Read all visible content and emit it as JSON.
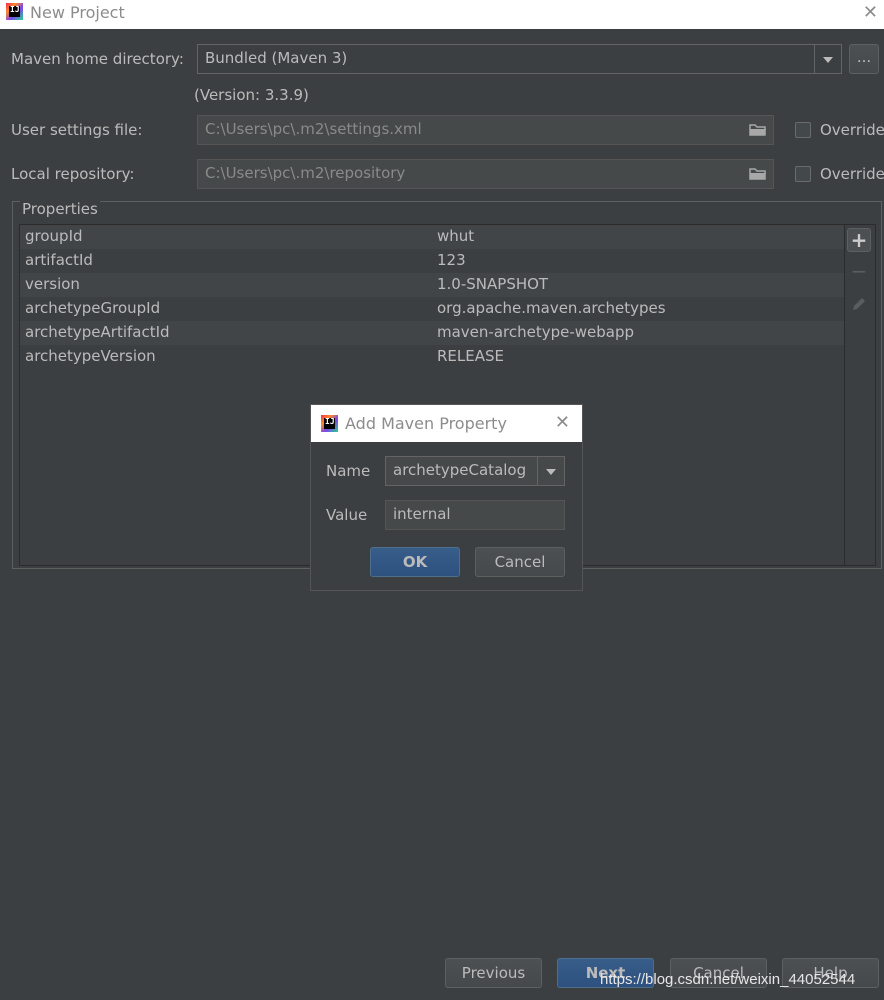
{
  "window": {
    "title": "New Project"
  },
  "maven": {
    "home_label": "Maven home directory:",
    "home_value": "Bundled (Maven 3)",
    "browse_label": "...",
    "version_text": "(Version: 3.3.9)",
    "settings_label": "User settings file:",
    "settings_value": "C:\\Users\\pc\\.m2\\settings.xml",
    "repo_label": "Local repository:",
    "repo_value": "C:\\Users\\pc\\.m2\\repository",
    "override_label": "Override"
  },
  "properties": {
    "legend": "Properties",
    "rows": [
      {
        "key": "groupId",
        "value": "whut"
      },
      {
        "key": "artifactId",
        "value": "123"
      },
      {
        "key": "version",
        "value": "1.0-SNAPSHOT"
      },
      {
        "key": "archetypeGroupId",
        "value": "org.apache.maven.archetypes"
      },
      {
        "key": "archetypeArtifactId",
        "value": "maven-archetype-webapp"
      },
      {
        "key": "archetypeVersion",
        "value": "RELEASE"
      }
    ],
    "add_symbol": "+",
    "remove_symbol": "−"
  },
  "dialog": {
    "title": "Add Maven Property",
    "name_label": "Name",
    "name_value": "archetypeCatalog",
    "value_label": "Value",
    "value_value": "internal",
    "ok_label": "OK",
    "cancel_label": "Cancel"
  },
  "footer": {
    "previous_label": "Previous",
    "next_label": "Next",
    "cancel_label": "Cancel",
    "help_label": "Help"
  },
  "watermark": "https://blog.csdn.net/weixin_44052544",
  "colors": {
    "background": "#3c3f41",
    "text": "#bbbbbb",
    "primary_button": "#365880",
    "titlebar": "#ffffff"
  }
}
